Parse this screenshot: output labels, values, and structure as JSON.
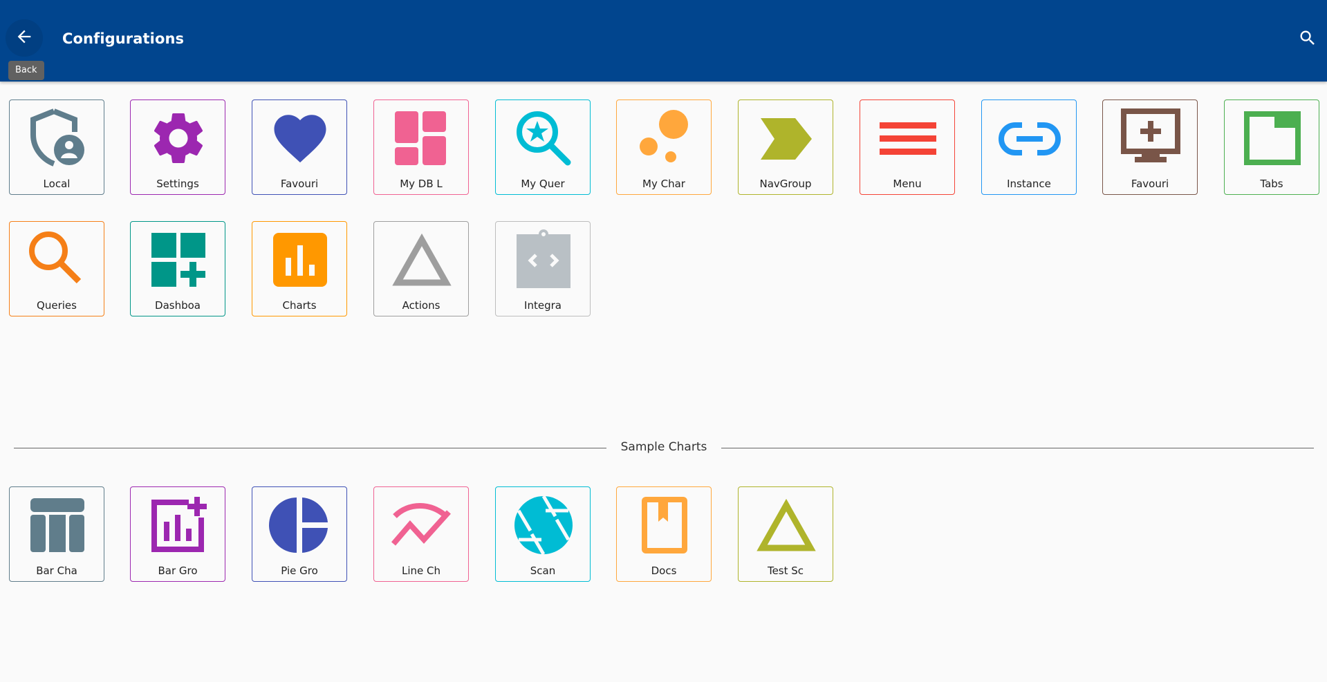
{
  "header": {
    "title": "Configurations",
    "back_tooltip": "Back"
  },
  "icons": {
    "back": "arrow-left-icon",
    "search": "search-icon"
  },
  "tiles": [
    {
      "label": "Local",
      "icon": "shield-account-icon",
      "color": "#5f7d8c"
    },
    {
      "label": "Settings",
      "icon": "gear-icon",
      "color": "#9c27b0"
    },
    {
      "label": "Favouri",
      "icon": "heart-icon",
      "color": "#3f51b5"
    },
    {
      "label": "My DB L",
      "icon": "dashboard-grid-icon",
      "color": "#f06292"
    },
    {
      "label": "My Quer",
      "icon": "search-star-icon",
      "color": "#00bcd4"
    },
    {
      "label": "My Char",
      "icon": "bubble-chart-icon",
      "color": "#ffa73c"
    },
    {
      "label": "NavGroup",
      "icon": "chevron-arrow-icon",
      "color": "#afb42b"
    },
    {
      "label": "Menu",
      "icon": "menu-icon",
      "color": "#f44336"
    },
    {
      "label": "Instance",
      "icon": "link-icon",
      "color": "#2196f3"
    },
    {
      "label": "Favouri",
      "icon": "monitor-plus-icon",
      "color": "#795548"
    },
    {
      "label": "Tabs",
      "icon": "tab-icon",
      "color": "#4caf50"
    },
    {
      "label": "Queries",
      "icon": "search-icon",
      "color": "#f57f17"
    },
    {
      "label": "Dashboa",
      "icon": "dashboard-add-icon",
      "color": "#009688"
    },
    {
      "label": "Charts",
      "icon": "bar-chart-icon",
      "color": "#ff9800"
    },
    {
      "label": "Actions",
      "icon": "triangle-icon",
      "color": "#9e9e9e"
    },
    {
      "label": "Integra",
      "icon": "clipboard-code-icon",
      "color": "#bdbdbd"
    }
  ],
  "section": {
    "title": "Sample Charts"
  },
  "sample_tiles": [
    {
      "label": "Bar Cha",
      "icon": "table-columns-icon",
      "color": "#607d8b"
    },
    {
      "label": "Bar Gro",
      "icon": "chart-add-icon",
      "color": "#9c27b0"
    },
    {
      "label": "Pie Gro",
      "icon": "pie-chart-icon",
      "color": "#3f51b5"
    },
    {
      "label": "Line Ch",
      "icon": "line-chart-icon",
      "color": "#f06292"
    },
    {
      "label": "Scan",
      "icon": "camera-shutter-icon",
      "color": "#00bcd4"
    },
    {
      "label": "Docs",
      "icon": "book-icon",
      "color": "#ffa73c"
    },
    {
      "label": "Test Sc",
      "icon": "triangle-icon",
      "color": "#afb42b"
    }
  ]
}
